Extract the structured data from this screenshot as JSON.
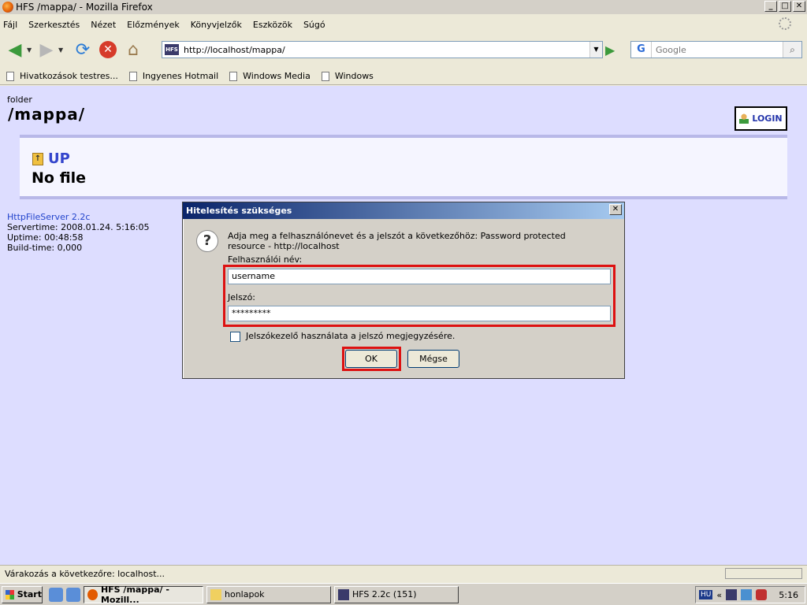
{
  "window": {
    "title": "HFS /mappa/ - Mozilla Firefox",
    "controls": [
      "_",
      "□",
      "✕"
    ]
  },
  "menu": [
    "Fájl",
    "Szerkesztés",
    "Nézet",
    "Előzmények",
    "Könyvjelzők",
    "Eszközök",
    "Súgó"
  ],
  "nav": {
    "url": "http://localhost/mappa/",
    "site_badge": "HFS",
    "search_placeholder": "Google",
    "search_engine": "G"
  },
  "bookmarks": [
    "Hivatkozások testres...",
    "Ingyenes Hotmail",
    "Windows Media",
    "Windows"
  ],
  "page": {
    "folder_label": "folder",
    "folder_path": "/mappa/",
    "login_label": "LOGIN",
    "up_label": "UP",
    "no_file": "No file",
    "server_name": "HttpFileServer 2.2c",
    "servertime": "Servertime: 2008.01.24. 5:16:05",
    "uptime": "Uptime: 00:48:58",
    "buildtime": "Build-time: 0,000"
  },
  "dialog": {
    "title": "Hitelesítés szükséges",
    "close": "✕",
    "icon": "?",
    "message": "Adja meg a felhasználónevet és a jelszót a következőhöz: Password protected resource - http://localhost",
    "username_label": "Felhasználói név:",
    "username_value": "username",
    "password_label": "Jelszó:",
    "password_value": "*********",
    "remember_label": "Jelszókezelő használata a jelszó megjegyzésére.",
    "remember_checked": false,
    "ok_label": "OK",
    "cancel_label": "Mégse",
    "highlight_color": "#dd1111"
  },
  "status": {
    "text": "Várakozás a következőre: localhost..."
  },
  "taskbar": {
    "start": "Start",
    "tasks": [
      "HFS /mappa/ - Mozill...",
      "honlapok",
      "HFS 2.2c (151)"
    ],
    "tray_lang": "HU",
    "tray_chevron": "«",
    "clock": "5:16"
  },
  "colors": {
    "page_bg": "#ddddff",
    "panel_border": "#b8b8e8",
    "link": "#2244cc",
    "titlebar_dialog": "#0a246a"
  }
}
